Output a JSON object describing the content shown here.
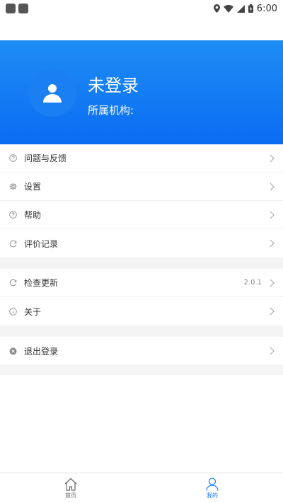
{
  "status_bar": {
    "time": "6:00"
  },
  "profile": {
    "username": "未登录",
    "org_label": "所属机构:"
  },
  "menu_group1": [
    {
      "label": "问题与反馈",
      "icon": "question-icon"
    },
    {
      "label": "设置",
      "icon": "gear-icon"
    },
    {
      "label": "帮助",
      "icon": "question-icon"
    },
    {
      "label": "评价记录",
      "icon": "refresh-icon"
    }
  ],
  "menu_group2": [
    {
      "label": "检查更新",
      "icon": "refresh-icon",
      "value": "2.0.1"
    },
    {
      "label": "关于",
      "icon": "info-icon"
    }
  ],
  "menu_group3": [
    {
      "label": "退出登录",
      "icon": "close-circle-icon"
    }
  ],
  "tabs": [
    {
      "label": "首页",
      "icon": "home-icon",
      "active": false
    },
    {
      "label": "我的",
      "icon": "person-icon",
      "active": true
    }
  ],
  "colors": {
    "accent": "#1a7cf2",
    "header_gradient_start": "#1e8df5",
    "header_gradient_end": "#0a6cf2",
    "divider": "#f4f4f4"
  }
}
